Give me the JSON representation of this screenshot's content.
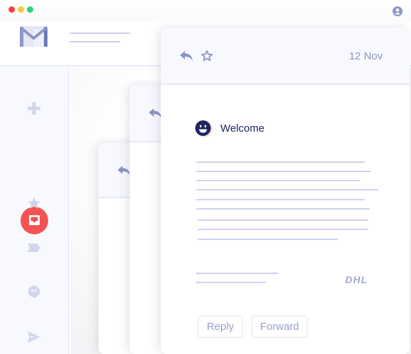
{
  "window": {
    "controls": [
      "close",
      "minimize",
      "maximize"
    ],
    "account_icon": "account-circle-icon"
  },
  "header": {
    "logo": "gmail-logo",
    "placeholder_lines": 2
  },
  "sidebar": {
    "items": [
      {
        "name": "compose",
        "icon": "plus-icon",
        "active": false
      },
      {
        "name": "inbox",
        "icon": "inbox-icon",
        "active": true
      },
      {
        "name": "starred",
        "icon": "star-icon",
        "active": false
      },
      {
        "name": "labels",
        "icon": "label-tag-icon",
        "active": false
      },
      {
        "name": "chat",
        "icon": "quote-bubble-icon",
        "active": false
      },
      {
        "name": "sent",
        "icon": "send-icon",
        "active": false
      }
    ]
  },
  "email": {
    "date": "12 Nov",
    "sender": "Welcome",
    "brand_logo_text": "DHL",
    "actions": {
      "reply_label": "Reply",
      "forward_label": "Forward"
    }
  },
  "colors": {
    "accent_red": "#f45353",
    "icon_muted": "#d1d5ec",
    "icon_active": "#8d96c6",
    "text_dark": "#1e2560",
    "line": "#cdd2ef"
  }
}
